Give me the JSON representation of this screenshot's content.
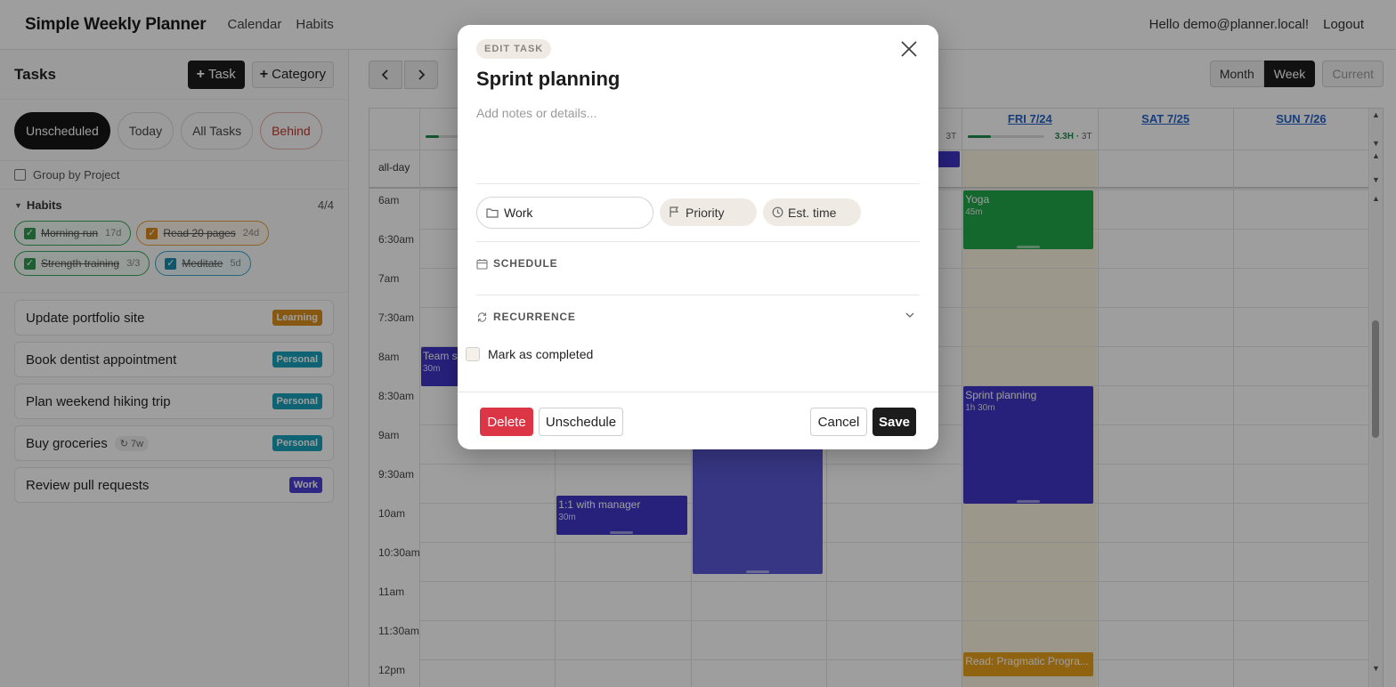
{
  "app": {
    "brand": "Simple Weekly Planner",
    "nav": [
      "Calendar",
      "Habits"
    ],
    "greeting": "Hello demo@planner.local!",
    "logout": "Logout"
  },
  "sidebar": {
    "title": "Tasks",
    "add_task": "Task",
    "add_category": "Category",
    "filters": [
      "Unscheduled",
      "Today",
      "All Tasks",
      "Behind"
    ],
    "active_filter": "Unscheduled",
    "group_by_project": "Group by Project",
    "habits_title": "Habits",
    "habits_count": "4/4",
    "habits": [
      {
        "name": "Morning run",
        "count": "17d",
        "color": "green",
        "done": true
      },
      {
        "name": "Read 20 pages",
        "count": "24d",
        "color": "orange",
        "done": true
      },
      {
        "name": "Strength training",
        "count": "3/3",
        "color": "green",
        "done": true
      },
      {
        "name": "Meditate",
        "count": "5d",
        "color": "teal",
        "done": true
      }
    ],
    "tasks": [
      {
        "name": "Update portfolio site",
        "tag": "Learning",
        "tag_color": "#d98e1c"
      },
      {
        "name": "Book dentist appointment",
        "tag": "Personal",
        "tag_color": "#1aa0b8"
      },
      {
        "name": "Plan weekend hiking trip",
        "tag": "Personal",
        "tag_color": "#1aa0b8"
      },
      {
        "name": "Buy groceries",
        "recurrence": "↻ 7w",
        "tag": "Personal",
        "tag_color": "#1aa0b8"
      },
      {
        "name": "Review pull requests",
        "tag": "Work",
        "tag_color": "#4b3fd4"
      }
    ]
  },
  "calendar": {
    "views": [
      "Month",
      "Week",
      "Current"
    ],
    "active_view": "Week",
    "days": [
      {
        "label": "",
        "progress": 0.18
      },
      {
        "label": "",
        "progress": null
      },
      {
        "label": "",
        "progress": null
      },
      {
        "label": "",
        "hours": "",
        "tasks": "3T",
        "progress": null
      },
      {
        "label": "FRI 7/24",
        "hours": "3.3H",
        "tasks": "3T",
        "progress": 0.3
      },
      {
        "label": "SAT 7/25",
        "progress": null
      },
      {
        "label": "SUN 7/26",
        "progress": null
      }
    ],
    "allday_label": "all-day",
    "times": [
      "6am",
      "6:30am",
      "7am",
      "7:30am",
      "8am",
      "8:30am",
      "9am",
      "9:30am",
      "10am",
      "10:30am",
      "11am",
      "11:30am",
      "12pm"
    ],
    "events": [
      {
        "day": 4,
        "name": "Yoga",
        "duration": "45m",
        "start": 6.0,
        "end": 6.75,
        "color": "green"
      },
      {
        "day": 0,
        "name": "Team s",
        "duration": "30m",
        "start": 8.0,
        "end": 8.5,
        "color": "purple"
      },
      {
        "day": 4,
        "name": "Sprint planning",
        "duration": "1h 30m",
        "start": 8.5,
        "end": 10.0,
        "color": "purple"
      },
      {
        "day": 1,
        "name": "1:1 with manager",
        "duration": "30m",
        "start": 9.9,
        "end": 10.4,
        "color": "purple"
      },
      {
        "day": 2,
        "name": "",
        "duration": "",
        "start": 9.2,
        "end": 10.9,
        "color": "purple2"
      },
      {
        "day": 4,
        "name": "Read: Pragmatic Progra...",
        "duration": "",
        "start": 11.9,
        "end": 12.2,
        "color": "orange"
      }
    ],
    "allday_events": [
      {
        "day": 3,
        "color": "purple"
      }
    ]
  },
  "modal": {
    "badge": "EDIT TASK",
    "title": "Sprint planning",
    "notes_placeholder": "Add notes or details...",
    "project": "Work",
    "priority": "Priority",
    "est_time": "Est. time",
    "schedule": "SCHEDULE",
    "recurrence": "RECURRENCE",
    "mark_completed": "Mark as completed",
    "delete": "Delete",
    "unschedule": "Unschedule",
    "cancel": "Cancel",
    "save": "Save"
  }
}
